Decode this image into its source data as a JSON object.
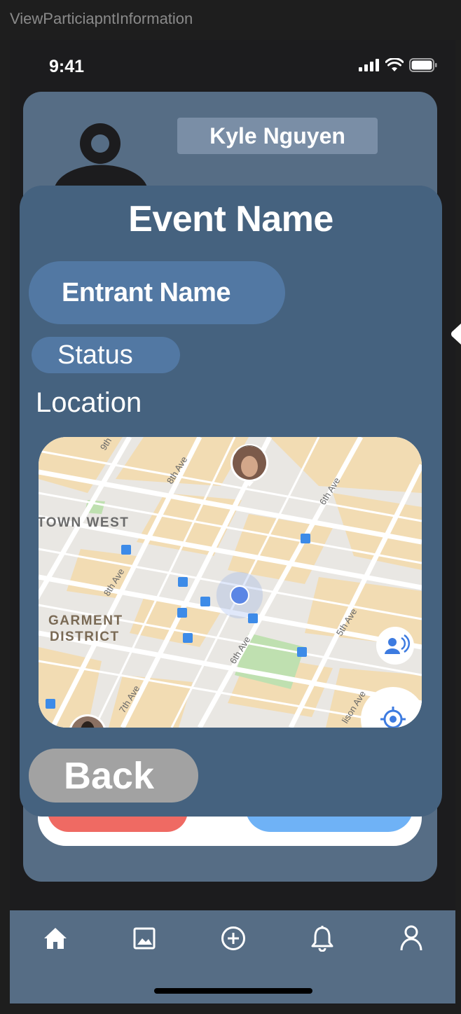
{
  "frame": {
    "title": "ViewParticiapntInformation"
  },
  "status_bar": {
    "time": "9:41"
  },
  "profile": {
    "name": "Kyle Nguyen"
  },
  "modal": {
    "event_name": "Event Name",
    "entrant_name": "Entrant Name",
    "status": "Status",
    "location_label": "Location",
    "back_label": "Back"
  },
  "map": {
    "labels": {
      "neighborhood_1": "TOWN WEST",
      "neighborhood_2_line1": "GARMENT",
      "neighborhood_2_line2": "DISTRICT",
      "street_9th": "9th",
      "street_8th_a": "8th Ave",
      "street_8th_b": "8th Ave",
      "street_7th": "7th Ave",
      "street_6th_a": "6th Ave",
      "street_6th_b": "6th Ave",
      "street_5th": "5th Ave",
      "street_madison": "lison Ave"
    }
  },
  "tab_bar": {
    "items": [
      "home-icon",
      "gallery-icon",
      "add-icon",
      "notifications-icon",
      "profile-icon"
    ]
  },
  "colors": {
    "card": "#566d85",
    "modal": "#45627f",
    "pill": "#5278a3",
    "back": "#a2a2a2",
    "red": "#ef6a63",
    "blue": "#6fb2f6"
  }
}
